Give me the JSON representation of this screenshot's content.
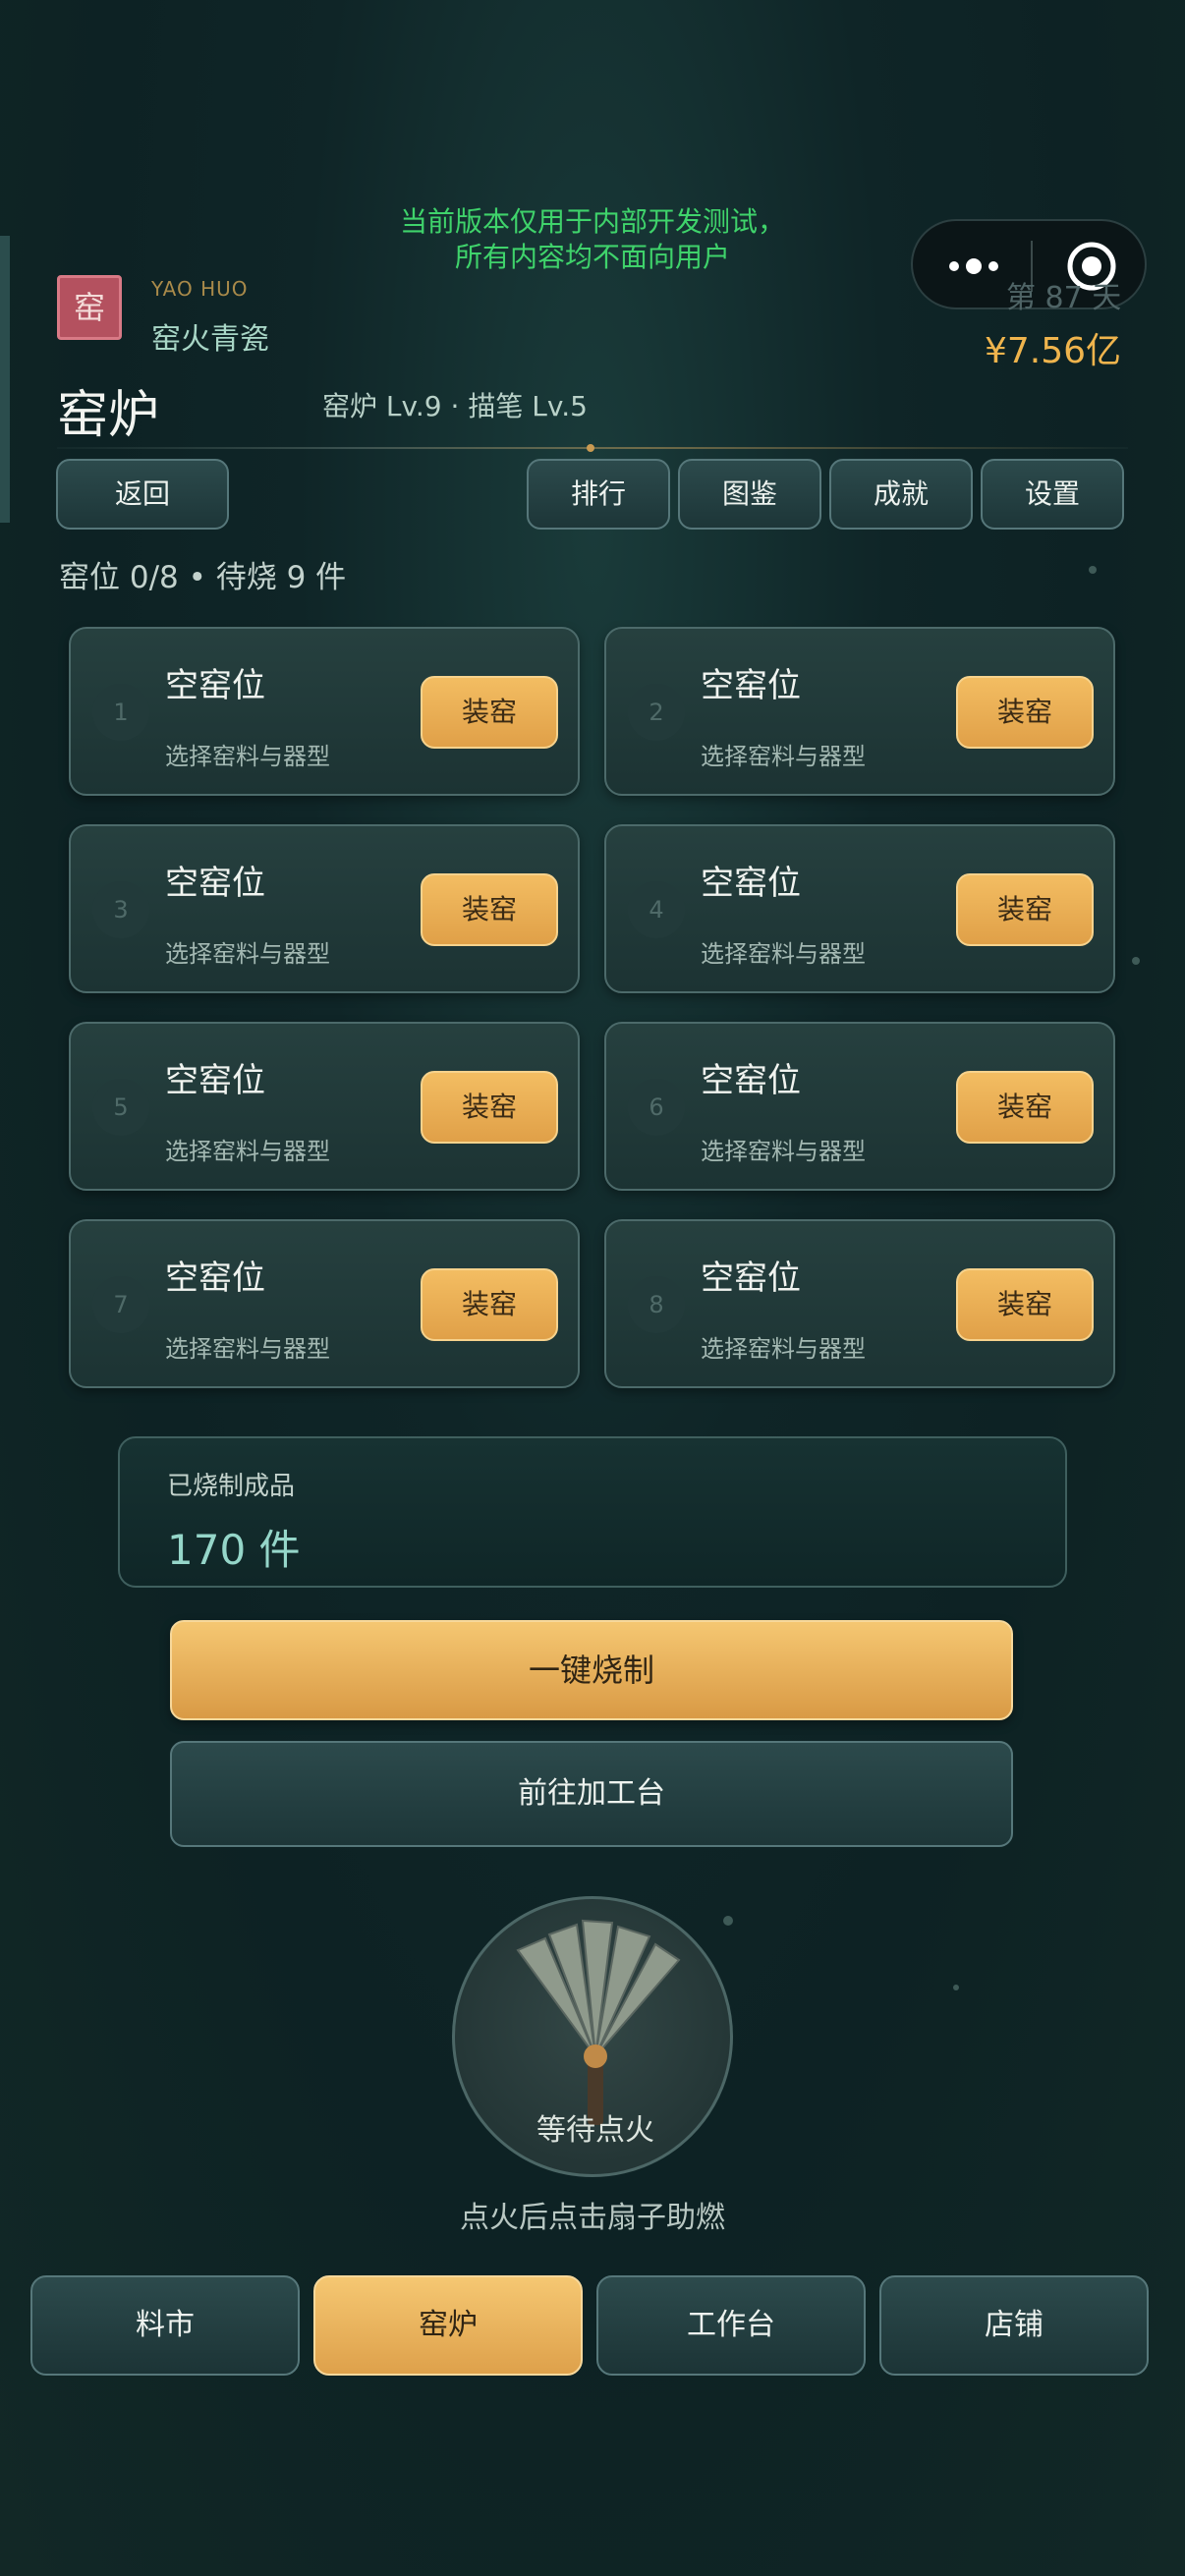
{
  "dev_notice": {
    "line1": "当前版本仅用于内部开发测试，",
    "line2": "所有内容均不面向用户"
  },
  "capsule": {
    "more_icon": "more-dots-icon",
    "close_icon": "target-circle-icon"
  },
  "header": {
    "seal_char": "窑",
    "brand_en": "YAO HUO",
    "brand_cn": "窑火青瓷",
    "day": "第 87 天",
    "money": "¥7.56亿",
    "title": "窑炉",
    "subtitle": "窑炉 Lv.9 · 描笔 Lv.5"
  },
  "nav": {
    "back": "返回",
    "rank": "排行",
    "codex": "图鉴",
    "achievements": "成就",
    "settings": "设置"
  },
  "slot_status": "窑位 0/8 • 待烧 9 件",
  "slots": [
    {
      "num": "1",
      "name": "空窑位",
      "hint": "选择窑料与器型",
      "action": "装窑"
    },
    {
      "num": "2",
      "name": "空窑位",
      "hint": "选择窑料与器型",
      "action": "装窑"
    },
    {
      "num": "3",
      "name": "空窑位",
      "hint": "选择窑料与器型",
      "action": "装窑"
    },
    {
      "num": "4",
      "name": "空窑位",
      "hint": "选择窑料与器型",
      "action": "装窑"
    },
    {
      "num": "5",
      "name": "空窑位",
      "hint": "选择窑料与器型",
      "action": "装窑"
    },
    {
      "num": "6",
      "name": "空窑位",
      "hint": "选择窑料与器型",
      "action": "装窑"
    },
    {
      "num": "7",
      "name": "空窑位",
      "hint": "选择窑料与器型",
      "action": "装窑"
    },
    {
      "num": "8",
      "name": "空窑位",
      "hint": "选择窑料与器型",
      "action": "装窑"
    }
  ],
  "fired": {
    "label": "已烧制成品",
    "value": "170 件"
  },
  "actions": {
    "fire_all": "一键烧制",
    "go_bench": "前往加工台"
  },
  "fan": {
    "icon": "fan-icon",
    "status": "等待点火",
    "hint": "点火后点击扇子助燃"
  },
  "tabs": [
    {
      "label": "料市",
      "active": false
    },
    {
      "label": "窑炉",
      "active": true
    },
    {
      "label": "工作台",
      "active": false
    },
    {
      "label": "店铺",
      "active": false
    }
  ],
  "colors": {
    "accent": "#e0a048",
    "bg": "#0f2527",
    "notice": "#3fd36b"
  }
}
